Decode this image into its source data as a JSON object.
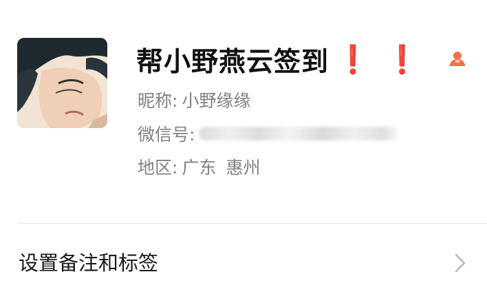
{
  "profile": {
    "display_name": "帮小野燕云签到",
    "marks": [
      "❗",
      "❗"
    ],
    "nickname_label": "昵称:",
    "nickname_value": "小野缘缘",
    "wechat_id_label": "微信号:",
    "region_label": "地区:",
    "region_province": "广东",
    "region_city": "惠州",
    "gender_icon": "person-icon",
    "colors": {
      "name": "#111111",
      "meta": "#808080",
      "mark": "#e0242b",
      "gender_icon": "#f2704a"
    }
  },
  "actions": {
    "set_remark_label": "设置备注和标签"
  }
}
